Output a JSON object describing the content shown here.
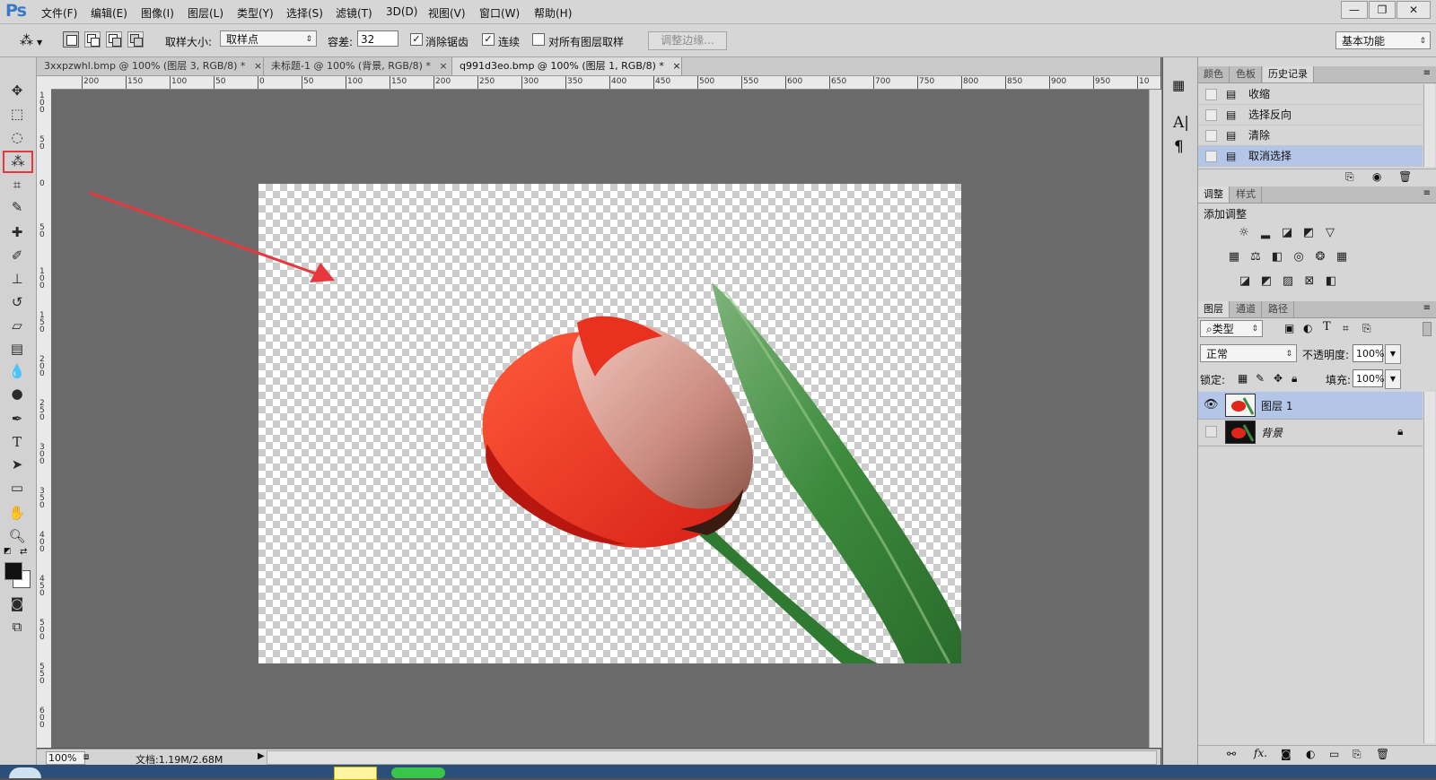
{
  "app": {
    "logo": "Ps"
  },
  "menu": [
    "文件(F)",
    "编辑(E)",
    "图像(I)",
    "图层(L)",
    "类型(Y)",
    "选择(S)",
    "滤镜(T)",
    "3D(D)",
    "视图(V)",
    "窗口(W)",
    "帮助(H)"
  ],
  "window_controls": {
    "minimize": "—",
    "restore": "❐",
    "close": "✕"
  },
  "options": {
    "sample_size_label": "取样大小:",
    "sample_size_value": "取样点",
    "tolerance_label": "容差:",
    "tolerance_value": "32",
    "antialias_label": "消除锯齿",
    "antialias_checked": true,
    "contiguous_label": "连续",
    "contiguous_checked": true,
    "all_layers_label": "对所有图层取样",
    "all_layers_checked": false,
    "refine_edge_label": "调整边缘...",
    "workspace": "基本功能"
  },
  "tabs": [
    {
      "label": "3xxpzwhl.bmp @ 100% (图层 3, RGB/8) *",
      "close": "×",
      "active": false
    },
    {
      "label": "未标题-1 @ 100% (背景, RGB/8) *",
      "close": "×",
      "active": false
    },
    {
      "label": "q991d3eo.bmp @ 100% (图层 1, RGB/8) *",
      "close": "×",
      "active": true
    }
  ],
  "ruler": {
    "h_ticks": [
      "200",
      "150",
      "100",
      "50",
      "0",
      "50",
      "100",
      "150",
      "200",
      "250",
      "300",
      "350",
      "400",
      "450",
      "500",
      "550",
      "600",
      "650",
      "700",
      "750",
      "800",
      "850",
      "900",
      "950",
      "10"
    ],
    "v_ticks": [
      "1 0 0",
      "5 0",
      "0",
      "5 0",
      "1 0 0",
      "1 5 0",
      "2 0 0",
      "2 5 0",
      "3 0 0",
      "3 5 0",
      "4 0 0",
      "4 5 0",
      "5 0 0",
      "5 5 0",
      "6 0 0"
    ]
  },
  "status": {
    "zoom": "100%",
    "doc_info": "文档:1.19M/2.68M"
  },
  "history_panel": {
    "tabs": [
      "颜色",
      "色板",
      "历史记录"
    ],
    "items": [
      "收缩",
      "选择反向",
      "清除",
      "取消选择"
    ],
    "selected_index": 3
  },
  "adjust_panel": {
    "tabs": [
      "调整",
      "样式"
    ],
    "title": "添加调整",
    "row1": [
      "sun-icon",
      "levels-icon",
      "curves-icon",
      "exposure-icon",
      "vibrance-icon"
    ],
    "row2": [
      "hue-icon",
      "balance-icon",
      "bw-icon",
      "photo-filter-icon",
      "channel-mixer-icon",
      "lookup-icon"
    ],
    "row3": [
      "invert-icon",
      "posterize-icon",
      "threshold-icon",
      "selective-color-icon",
      "gradient-map-icon"
    ]
  },
  "layers_panel": {
    "tabs": [
      "图层",
      "通道",
      "路径"
    ],
    "filter_type": "类型",
    "blend_mode": "正常",
    "opacity_label": "不透明度:",
    "opacity_value": "100%",
    "lock_label": "锁定:",
    "fill_label": "填充:",
    "fill_value": "100%",
    "layers": [
      {
        "name": "图层 1",
        "visible": true,
        "selected": true,
        "locked": false
      },
      {
        "name": "背景",
        "visible": false,
        "selected": false,
        "locked": true
      }
    ]
  },
  "colors": {
    "selection_highlight": "#b4c6e7",
    "annotation_red": "#e8383d",
    "canvas_bg": "#6b6b6b",
    "ps_blue": "#3a79c5"
  }
}
